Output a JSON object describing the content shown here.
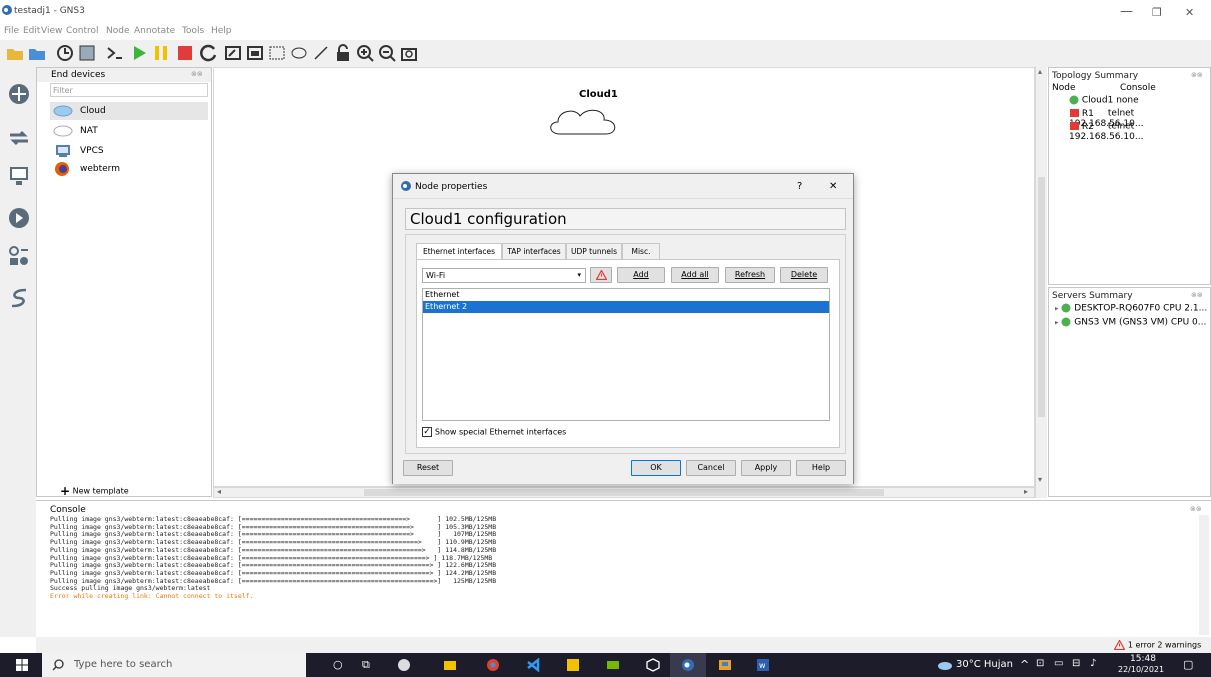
{
  "window": {
    "title": "testadj1 - GNS3",
    "minimize": "—",
    "maximize": "❐",
    "close": "✕"
  },
  "menu": [
    "File",
    "Edit",
    "View",
    "Control",
    "Node",
    "Annotate",
    "Tools",
    "Help"
  ],
  "devices_panel": {
    "title": "End devices",
    "filter_placeholder": "Filter",
    "items": [
      "Cloud",
      "NAT",
      "VPCS",
      "webterm"
    ],
    "new_template": "New template"
  },
  "canvas": {
    "node_label": "Cloud1"
  },
  "topology": {
    "title": "Topology Summary",
    "col_node": "Node",
    "col_console": "Console",
    "rows": [
      {
        "node": "Cloud1",
        "console": "none",
        "color": "#4caf50"
      },
      {
        "node": "R1",
        "console": "telnet 192.168.56.10...",
        "color": "#e53935"
      },
      {
        "node": "R2",
        "console": "telnet 192.168.56.10...",
        "color": "#e53935"
      }
    ]
  },
  "servers": {
    "title": "Servers Summary",
    "items": [
      "DESKTOP-RQ607F0 CPU 2.1...",
      "GNS3 VM (GNS3 VM) CPU 0..."
    ]
  },
  "dialog": {
    "title": "Node properties",
    "help": "?",
    "close": "✕",
    "heading": "Cloud1 configuration",
    "tabs": [
      "Ethernet interfaces",
      "TAP interfaces",
      "UDP tunnels",
      "Misc."
    ],
    "selected_interface": "Wi-Fi",
    "buttons": {
      "add": "Add",
      "add_all": "Add all",
      "refresh": "Refresh",
      "delete": "Delete"
    },
    "interfaces": [
      "Ethernet",
      "Ethernet 2"
    ],
    "checkbox_label": "Show special Ethernet interfaces",
    "reset": "Reset",
    "ok": "OK",
    "cancel": "Cancel",
    "apply": "Apply",
    "help_btn": "Help"
  },
  "console": {
    "title": "Console",
    "lines": [
      "Pulling image gns3/webterm:latest:c8eaeabe8caf: [==========================================>       ] 102.5MB/125MB",
      "Pulling image gns3/webterm:latest:c8eaeabe8caf: [===========================================>      ] 105.3MB/125MB",
      "Pulling image gns3/webterm:latest:c8eaeabe8caf: [===========================================>      ]   107MB/125MB",
      "Pulling image gns3/webterm:latest:c8eaeabe8caf: [=============================================>    ] 110.9MB/125MB",
      "Pulling image gns3/webterm:latest:c8eaeabe8caf: [==============================================>   ] 114.8MB/125MB",
      "Pulling image gns3/webterm:latest:c8eaeabe8caf: [===============================================> ] 118.7MB/125MB",
      "Pulling image gns3/webterm:latest:c8eaeabe8caf: [================================================> ] 122.6MB/125MB",
      "Pulling image gns3/webterm:latest:c8eaeabe8caf: [================================================> ] 124.2MB/125MB",
      "Pulling image gns3/webterm:latest:c8eaeabe8caf: [=================================================>]   125MB/125MB",
      "Success pulling image gns3/webterm:latest"
    ],
    "error_line": "Error while creating link: Cannot connect to itself."
  },
  "status": {
    "errors": "1 error 2 warnings"
  },
  "taskbar": {
    "search": "Type here to search",
    "weather": "30°C Hujan",
    "time": "15:48",
    "date": "22/10/2021"
  }
}
